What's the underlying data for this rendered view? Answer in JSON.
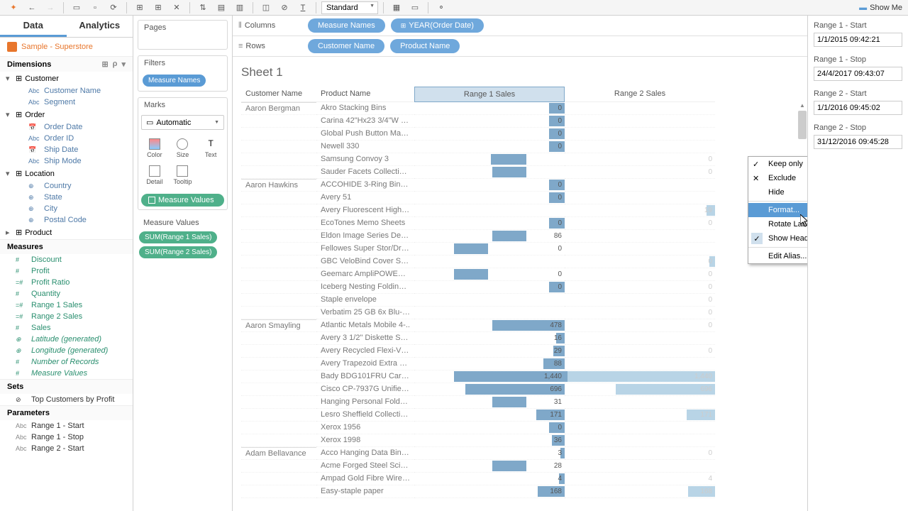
{
  "toolbar": {
    "standard": "Standard",
    "show_me": "Show Me"
  },
  "data_tabs": {
    "data": "Data",
    "analytics": "Analytics"
  },
  "datasource": "Sample - Superstore",
  "sections": {
    "dimensions": "Dimensions",
    "measures": "Measures",
    "sets": "Sets",
    "parameters": "Parameters"
  },
  "dim_groups": {
    "customer": "Customer",
    "customer_name": "Customer Name",
    "segment": "Segment",
    "order": "Order",
    "order_date": "Order Date",
    "order_id": "Order ID",
    "ship_date": "Ship Date",
    "ship_mode": "Ship Mode",
    "location": "Location",
    "country": "Country",
    "state": "State",
    "city": "City",
    "postal": "Postal Code",
    "product": "Product"
  },
  "measures": {
    "discount": "Discount",
    "profit": "Profit",
    "profit_ratio": "Profit Ratio",
    "quantity": "Quantity",
    "r1": "Range 1 Sales",
    "r2": "Range 2 Sales",
    "sales": "Sales",
    "lat": "Latitude (generated)",
    "lon": "Longitude (generated)",
    "nrec": "Number of Records",
    "mval": "Measure Values"
  },
  "sets": {
    "top": "Top Customers by Profit"
  },
  "param_list": {
    "r1s": "Range 1 - Start",
    "r1e": "Range 1 - Stop",
    "r2s": "Range 2 - Start"
  },
  "shelves": {
    "pages": "Pages",
    "filters": "Filters",
    "marks": "Marks",
    "mvalues": "Measure Values",
    "automatic": "Automatic",
    "measure_names": "Measure Names",
    "measure_values": "Measure Values",
    "sum_r1": "SUM(Range 1 Sales)",
    "sum_r2": "SUM(Range 2 Sales)",
    "color": "Color",
    "size": "Size",
    "text": "Text",
    "detail": "Detail",
    "tooltip": "Tooltip"
  },
  "cols_rows": {
    "columns": "Columns",
    "rows": "Rows",
    "measure_names": "Measure Names",
    "year_order": "YEAR(Order Date)",
    "customer_name": "Customer Name",
    "product_name": "Product Name"
  },
  "sheet": {
    "title": "Sheet 1"
  },
  "headers": {
    "cust": "Customer Name",
    "prod": "Product Name",
    "r1": "Range 1 Sales",
    "r2": "Range 2 Sales"
  },
  "rows_data": [
    {
      "c": "Aaron Bergman",
      "p": "Akro Stacking Bins",
      "r1": "0",
      "w1": 22
    },
    {
      "c": "",
      "p": "Carina 42\"Hx23 3/4\"W M..",
      "r1": "0",
      "w1": 22
    },
    {
      "c": "",
      "p": "Global Push Button Mana..",
      "r1": "0",
      "w1": 22
    },
    {
      "c": "",
      "p": "Newell 330",
      "r1": "0",
      "w1": 22
    },
    {
      "c": "",
      "p": "Samsung Convoy 3",
      "r1": "",
      "w1": 50,
      "off": 52,
      "r2": "0"
    },
    {
      "c": "",
      "p": "Sauder Facets Collection L..",
      "r1": "",
      "w1": 48,
      "off": 54,
      "r2": "0"
    },
    {
      "c": "Aaron Hawkins",
      "p": "ACCOHIDE 3-Ring Binder,..",
      "r1": "0",
      "w1": 22
    },
    {
      "c": "",
      "p": "Avery 51",
      "r1": "0",
      "w1": 22
    },
    {
      "c": "",
      "p": "Avery Fluorescent Highlig..",
      "r1": "",
      "r2": "19",
      "w2": 12
    },
    {
      "c": "",
      "p": "EcoTones Memo Sheets",
      "r1": "0",
      "w1": 22,
      "r2": "0"
    },
    {
      "c": "",
      "p": "Eldon Image Series Desk ..",
      "r1": "86",
      "w1": 48,
      "off": 54,
      "r2": ""
    },
    {
      "c": "",
      "p": "Fellowes Super Stor/Draw..",
      "r1": "0",
      "w1": 48,
      "off": 0,
      "r2": ""
    },
    {
      "c": "",
      "p": "GBC VeloBind Cover Sets",
      "r1": "",
      "r2": "0",
      "w2": 8
    },
    {
      "c": "",
      "p": "Geemarc AmpliPOWER60",
      "r1": "0",
      "w1": 48,
      "off": 0,
      "r2": "0"
    },
    {
      "c": "",
      "p": "Iceberg Nesting Folding C..",
      "r1": "0",
      "w1": 22,
      "r2": "0"
    },
    {
      "c": "",
      "p": "Staple envelope",
      "r1": "",
      "r2": "0"
    },
    {
      "c": "",
      "p": "Verbatim 25 GB 6x Blu-ra..",
      "r1": "",
      "r2": "0"
    },
    {
      "c": "Aaron Smayling",
      "p": "Atlantic Metals Mobile 4-..",
      "r1": "478",
      "w1": 102,
      "off": 54,
      "r2": "0"
    },
    {
      "c": "",
      "p": "Avery 3 1/2\" Diskette Sto..",
      "r1": "16",
      "w1": 12,
      "off": 144,
      "r2": ""
    },
    {
      "c": "",
      "p": "Avery Recycled Flexi-View..",
      "r1": "29",
      "w1": 16,
      "off": 140,
      "r2": "0"
    },
    {
      "c": "",
      "p": "Avery Trapezoid Extra He..",
      "r1": "88",
      "w1": 30,
      "off": 126,
      "r2": ""
    },
    {
      "c": "",
      "p": "Bady BDG101FRU Card Pr..",
      "r1": "1,440",
      "w1": 208,
      "off": 0,
      "r2": "1,440",
      "w2": 208
    },
    {
      "c": "",
      "p": "Cisco CP-7937G Unified IP..",
      "r1": "696",
      "w1": 140,
      "off": 16,
      "r2": "696",
      "w2": 140
    },
    {
      "c": "",
      "p": "Hanging Personal Folder F..",
      "r1": "31",
      "w1": 48,
      "off": 54,
      "r2": ""
    },
    {
      "c": "",
      "p": "Lesro Sheffield Collection..",
      "r1": "171",
      "w1": 40,
      "off": 116,
      "r2": "171",
      "w2": 40
    },
    {
      "c": "",
      "p": "Xerox 1956",
      "r1": "0",
      "w1": 22,
      "r2": ""
    },
    {
      "c": "",
      "p": "Xerox 1998",
      "r1": "36",
      "w1": 18,
      "off": 138,
      "r2": ""
    },
    {
      "c": "Adam Bellavance",
      "p": "Acco Hanging Data Binders",
      "r1": "3",
      "w1": 6,
      "off": 150,
      "r2": "0"
    },
    {
      "c": "",
      "p": "Acme Forged Steel Scisso..",
      "r1": "28",
      "w1": 48,
      "off": 54,
      "r2": ""
    },
    {
      "c": "",
      "p": "Ampad Gold Fibre Wirebo..",
      "r1": "4",
      "w1": 8,
      "off": 148,
      "r2": "4"
    },
    {
      "c": "",
      "p": "Easy-staple paper",
      "r1": "168",
      "w1": 38,
      "off": 118,
      "r2": "168",
      "w2": 38
    }
  ],
  "context_menu": {
    "keep": "Keep only",
    "exclude": "Exclude",
    "hide": "Hide",
    "format": "Format...",
    "rotate": "Rotate Label",
    "show_header": "Show Header",
    "alias": "Edit Alias..."
  },
  "params": {
    "r1s_label": "Range 1 - Start",
    "r1s_val": "1/1/2015 09:42:21",
    "r1e_label": "Range 1 - Stop",
    "r1e_val": "24/4/2017 09:43:07",
    "r2s_label": "Range 2 - Start",
    "r2s_val": "1/1/2016 09:45:02",
    "r2e_label": "Range 2 - Stop",
    "r2e_val": "31/12/2016 09:45:28"
  }
}
